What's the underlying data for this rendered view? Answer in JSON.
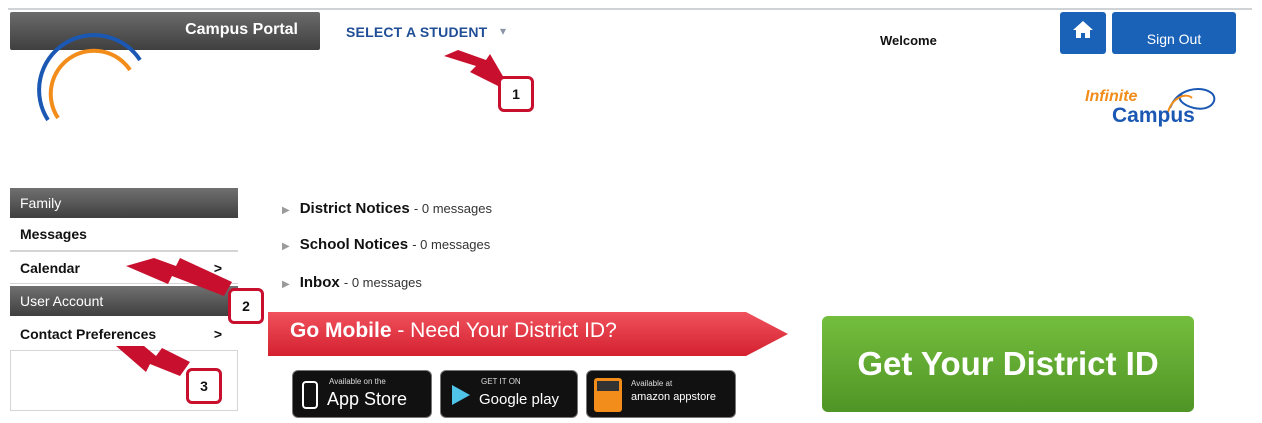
{
  "header": {
    "portal_title": "Campus Portal",
    "select_student": "SELECT A STUDENT",
    "welcome": "Welcome",
    "home_icon": "home-icon",
    "signout": "Sign Out"
  },
  "brand": {
    "infinite": "Infinite",
    "campus": "Campus"
  },
  "sidebar": {
    "sections": [
      {
        "title": "Family",
        "items": [
          {
            "label": "Messages",
            "chevron": false
          },
          {
            "label": "Calendar",
            "chevron": true
          }
        ]
      },
      {
        "title": "User Account",
        "items": [
          {
            "label": "Contact Preferences",
            "chevron": true
          }
        ]
      }
    ],
    "chevron_glyph": ">"
  },
  "messages": [
    {
      "name": "District Notices",
      "count": "- 0 messages"
    },
    {
      "name": "School Notices",
      "count": "- 0 messages"
    },
    {
      "name": "Inbox",
      "count": "- 0 messages"
    }
  ],
  "mobile": {
    "banner_bold": "Go Mobile",
    "banner_rest": " - Need Your District ID?",
    "get_id": "Get Your District ID",
    "badges": [
      {
        "small": "Available on the",
        "big": "App Store"
      },
      {
        "small": "GET IT ON",
        "big": "Google play"
      },
      {
        "small": "Available at",
        "big": "amazon appstore"
      }
    ]
  },
  "callouts": [
    "1",
    "2",
    "3"
  ],
  "colors": {
    "accent_blue": "#1a62b8",
    "nav_blue": "#1f4e96",
    "callout_red": "#c8102e",
    "banner_red": "#e53d4b",
    "green": "#5fa830",
    "orange": "#f28c1a"
  }
}
